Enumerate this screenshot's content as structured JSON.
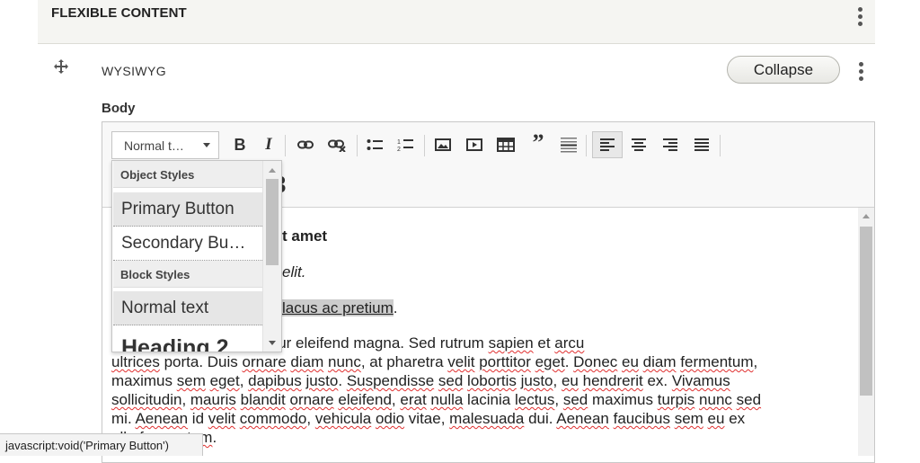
{
  "header": {
    "title": "FLEXIBLE CONTENT"
  },
  "paragraph": {
    "type_label": "WYSIWYG",
    "collapse_label": "Collapse"
  },
  "field": {
    "label": "Body"
  },
  "toolbar": {
    "style_dropdown_value": "Normal t…"
  },
  "style_menu": {
    "object_group": "Object Styles",
    "object_options": [
      "Primary Button",
      "Secondary Bu…"
    ],
    "block_group": "Block Styles",
    "block_options": [
      "Normal text",
      "Heading 2"
    ]
  },
  "content": {
    "line1_visible": "t amet",
    "line2_visible": "elit.",
    "line3_visible": "lacus ac pretium",
    "line3_after": ".",
    "para4": [
      {
        "t": "s nec lacus id, consectetur eleifend magna. Sed rutrum "
      },
      {
        "t": "sapien",
        "sq": true
      },
      {
        "t": " et "
      },
      {
        "t": "arcu",
        "sq": true
      },
      {
        "t": "\n"
      },
      {
        "t": "ultrices",
        "sq": true
      },
      {
        "t": " porta. Duis "
      },
      {
        "t": "ornare",
        "sq": true
      },
      {
        "t": " "
      },
      {
        "t": "diam",
        "sq": true
      },
      {
        "t": " "
      },
      {
        "t": "nunc",
        "sq": true
      },
      {
        "t": ", at pharetra "
      },
      {
        "t": "velit",
        "sq": true
      },
      {
        "t": " "
      },
      {
        "t": "porttitor",
        "sq": true
      },
      {
        "t": " "
      },
      {
        "t": "eget",
        "sq": true
      },
      {
        "t": ". "
      },
      {
        "t": "Donec",
        "sq": true
      },
      {
        "t": " "
      },
      {
        "t": "eu",
        "sq": true
      },
      {
        "t": " "
      },
      {
        "t": "diam",
        "sq": true
      },
      {
        "t": " "
      },
      {
        "t": "fermentum",
        "sq": true
      },
      {
        "t": ",\n"
      },
      {
        "t": "maximus "
      },
      {
        "t": "sem",
        "sq": true
      },
      {
        "t": " "
      },
      {
        "t": "eget",
        "sq": true
      },
      {
        "t": ", "
      },
      {
        "t": "dapibus",
        "sq": true
      },
      {
        "t": " "
      },
      {
        "t": "justo",
        "sq": true
      },
      {
        "t": ". "
      },
      {
        "t": "Suspendisse",
        "sq": true
      },
      {
        "t": " "
      },
      {
        "t": "sed",
        "sq": true
      },
      {
        "t": " "
      },
      {
        "t": "lobortis",
        "sq": true
      },
      {
        "t": " "
      },
      {
        "t": "justo",
        "sq": true
      },
      {
        "t": ", "
      },
      {
        "t": "eu",
        "sq": true
      },
      {
        "t": " "
      },
      {
        "t": "hendrerit",
        "sq": true
      },
      {
        "t": " ex. "
      },
      {
        "t": "Vivamus",
        "sq": true
      },
      {
        "t": "\n"
      },
      {
        "t": "sollicitudin",
        "sq": true
      },
      {
        "t": ", "
      },
      {
        "t": "mauris",
        "sq": true
      },
      {
        "t": " "
      },
      {
        "t": "blandit",
        "sq": true
      },
      {
        "t": " "
      },
      {
        "t": "ornare",
        "sq": true
      },
      {
        "t": " "
      },
      {
        "t": "eleifend",
        "sq": true
      },
      {
        "t": ", "
      },
      {
        "t": "erat",
        "sq": true
      },
      {
        "t": " "
      },
      {
        "t": "nulla",
        "sq": true
      },
      {
        "t": " lacinia "
      },
      {
        "t": "lectus",
        "sq": true
      },
      {
        "t": ", "
      },
      {
        "t": "sed",
        "sq": true
      },
      {
        "t": " maximus "
      },
      {
        "t": "turpis",
        "sq": true
      },
      {
        "t": " "
      },
      {
        "t": "nunc",
        "sq": true
      },
      {
        "t": " "
      },
      {
        "t": "sed",
        "sq": true
      },
      {
        "t": "\n"
      },
      {
        "t": "mi. "
      },
      {
        "t": "Aenean",
        "sq": true
      },
      {
        "t": " id "
      },
      {
        "t": "velit",
        "sq": true
      },
      {
        "t": " "
      },
      {
        "t": "commodo",
        "sq": true
      },
      {
        "t": ", "
      },
      {
        "t": "vehicula",
        "sq": true
      },
      {
        "t": " "
      },
      {
        "t": "odio",
        "sq": true
      },
      {
        "t": " vitae, "
      },
      {
        "t": "malesuada",
        "sq": true
      },
      {
        "t": " dui. "
      },
      {
        "t": "Aenean",
        "sq": true
      },
      {
        "t": " "
      },
      {
        "t": "faucibus",
        "sq": true
      },
      {
        "t": " "
      },
      {
        "t": "sem",
        "sq": true
      },
      {
        "t": " "
      },
      {
        "t": "eu",
        "sq": true
      },
      {
        "t": " ex\n"
      },
      {
        "t": "ulla fermentum",
        "sq": true
      },
      {
        "t": "."
      }
    ]
  },
  "status_bar": {
    "text": "javascript:void('Primary Button')"
  },
  "colors": {
    "header_bg": "#f5f5f2",
    "selection_bg": "#cccccc",
    "spell_underline": "#e03030"
  }
}
